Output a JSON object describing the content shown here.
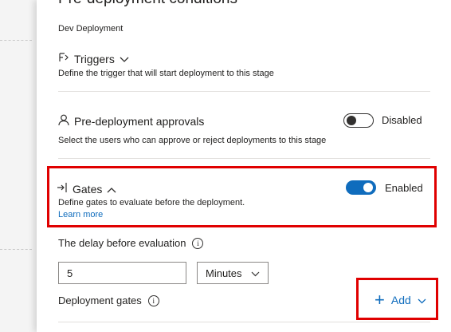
{
  "page": {
    "title": "Pre-deployment conditions",
    "subtitle": "Dev Deployment"
  },
  "triggers": {
    "label": "Triggers",
    "description": "Define the trigger that will start deployment to this stage",
    "icon": "triggers-icon"
  },
  "approvals": {
    "label": "Pre-deployment approvals",
    "description": "Select the users who can approve or reject deployments to this stage",
    "toggle_state": "Disabled",
    "icon": "person-icon"
  },
  "gates": {
    "label": "Gates",
    "description": "Define gates to evaluate before the deployment.",
    "link": "Learn more",
    "toggle_state": "Enabled",
    "icon": "gate-enter-icon"
  },
  "delay": {
    "label": "The delay before evaluation",
    "value": "5",
    "unit": "Minutes"
  },
  "deployment_gates": {
    "label": "Deployment gates",
    "add_label": "Add"
  },
  "colors": {
    "accent": "#0f6cbd",
    "highlight": "#e00000"
  }
}
